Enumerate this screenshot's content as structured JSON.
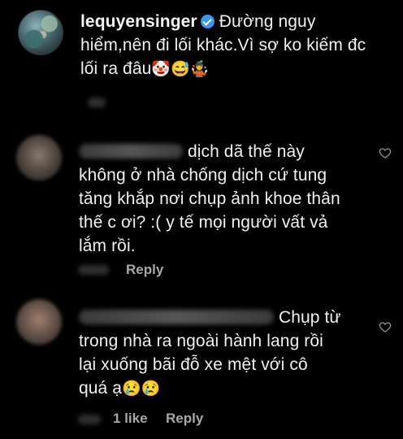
{
  "comments": [
    {
      "username": "lequyensinger",
      "text_line1": "Đường nguy",
      "text_line2": "hiểm,nên đi lối khác.Vì sợ ko kiếm đc",
      "text_line3": "lối ra đâu",
      "emojis": "🤡😅🤹"
    },
    {
      "text_line1": "dịch dã thế này",
      "text_line2": "không ở nhà chống dịch cứ tung",
      "text_line3": "tăng khắp nơi chụp ảnh khoe thân",
      "text_line4": "thế c ơi? :( y tế mọi người vất vả",
      "text_line5": "lắm rồi.",
      "reply_label": "Reply"
    },
    {
      "text_line1": "Chụp từ",
      "text_line2": "trong nhà ra ngoài hành lang rồi",
      "text_line3": "lại xuống bãi đỗ xe mệt với cô",
      "text_line4": "quá ạ",
      "emojis": "😢😢",
      "likes_label": "1 like",
      "reply_label": "Reply"
    }
  ],
  "icons": {
    "heart": "heart-icon",
    "verified": "verified-badge-icon"
  }
}
